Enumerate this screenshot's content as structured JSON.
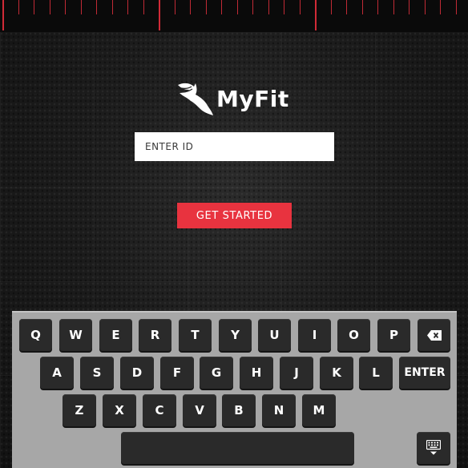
{
  "brand": {
    "name": "MyFit"
  },
  "login": {
    "id_placeholder": "ENTER ID",
    "start_label": "GET STARTED"
  },
  "keyboard": {
    "row1": [
      "Q",
      "W",
      "E",
      "R",
      "T",
      "Y",
      "U",
      "I",
      "O",
      "P"
    ],
    "row2": [
      "A",
      "S",
      "D",
      "F",
      "G",
      "H",
      "J",
      "K",
      "L"
    ],
    "row3": [
      "Z",
      "X",
      "C",
      "V",
      "B",
      "N",
      "M"
    ],
    "enter_label": "ENTER",
    "backspace_icon": "backspace-icon",
    "hide_icon": "keyboard-hide-icon"
  },
  "colors": {
    "accent": "#e8333f",
    "ruler_ticks": "#c02a35",
    "keyboard_bg": "#a7a7a7",
    "key_bg": "#2a2a2a"
  }
}
